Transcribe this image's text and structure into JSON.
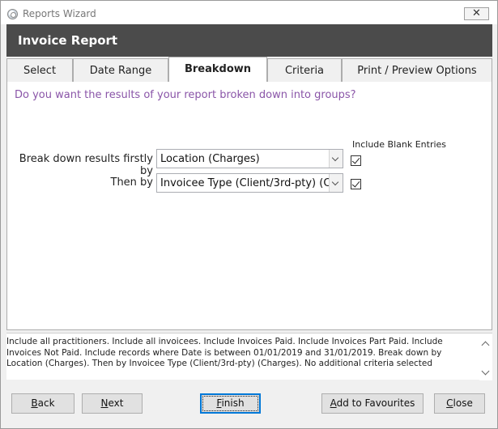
{
  "window": {
    "title": "Reports Wizard",
    "close_glyph": "✕"
  },
  "header": {
    "title": "Invoice Report"
  },
  "tabs": [
    {
      "label": "Select",
      "active": false
    },
    {
      "label": "Date Range",
      "active": false
    },
    {
      "label": "Breakdown",
      "active": true
    },
    {
      "label": "Criteria",
      "active": false
    },
    {
      "label": "Print / Preview Options",
      "active": false
    }
  ],
  "breakdown": {
    "question": "Do you want the results of your report broken down into groups?",
    "include_blank_label": "Include Blank Entries",
    "first": {
      "label": "Break down results firstly by",
      "value": "Location (Charges)",
      "include_blank": true
    },
    "then": {
      "label": "Then by",
      "value": "Invoicee Type (Client/3rd-pty) (Charges)",
      "include_blank": true
    }
  },
  "summary": {
    "text": "Include all practitioners. Include all invoicees. Include Invoices Paid. Include Invoices Part Paid. Include Invoices Not Paid. Include records where Date is between 01/01/2019 and 31/01/2019. Break down by Location (Charges). Then by Invoicee Type (Client/3rd-pty) (Charges). No additional criteria selected"
  },
  "buttons": {
    "back": {
      "mnemonic": "B",
      "rest": "ack"
    },
    "next": {
      "mnemonic": "N",
      "rest": "ext"
    },
    "finish": {
      "mnemonic": "F",
      "rest": "inish"
    },
    "favourites": {
      "mnemonic": "A",
      "rest": "dd to Favourites"
    },
    "close": {
      "mnemonic": "C",
      "rest": "lose"
    }
  },
  "icons": {
    "app": "app-icon",
    "close": "close-icon",
    "dropdown": "chevron-down-icon",
    "check": "checkmark-icon"
  }
}
